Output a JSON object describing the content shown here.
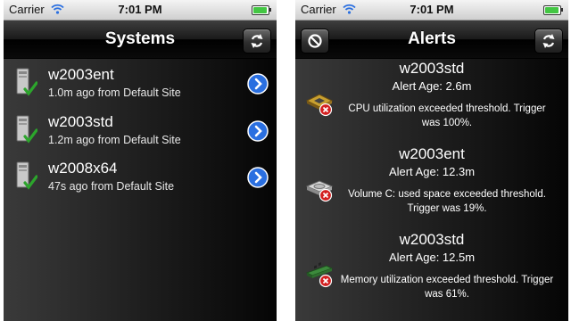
{
  "left_screen": {
    "status": {
      "carrier": "Carrier",
      "time": "7:01 PM"
    },
    "title": "Systems",
    "refresh_icon": "refresh-icon",
    "systems": [
      {
        "name": "w2003ent",
        "subtitle": "1.0m ago from Default Site"
      },
      {
        "name": "w2003std",
        "subtitle": "1.2m ago from Default Site"
      },
      {
        "name": "w2008x64",
        "subtitle": "47s ago from Default Site"
      }
    ]
  },
  "right_screen": {
    "status": {
      "carrier": "Carrier",
      "time": "7:01 PM"
    },
    "title": "Alerts",
    "cancel_icon": "no-entry-icon",
    "refresh_icon": "refresh-icon",
    "alerts": [
      {
        "system": "w2003std",
        "age": "Alert Age: 2.6m",
        "message": "CPU utilization exceeded threshold. Trigger was 100%.",
        "icon": "cpu-alert-icon"
      },
      {
        "system": "w2003ent",
        "age": "Alert Age: 12.3m",
        "message": "Volume C: used space exceeded threshold. Trigger was 19%.",
        "icon": "disk-alert-icon"
      },
      {
        "system": "w2003std",
        "age": "Alert Age: 12.5m",
        "message": "Memory utilization exceeded threshold. Trigger was 61%.",
        "icon": "memory-alert-icon"
      }
    ]
  },
  "colors": {
    "battery": "#43c643",
    "disclosure": "#2a6fe0",
    "error": "#d32020"
  }
}
